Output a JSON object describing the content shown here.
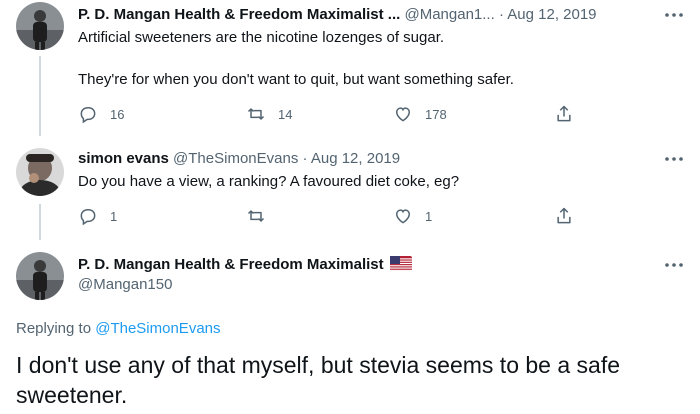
{
  "tweets": [
    {
      "name": "P. D. Mangan Health & Freedom Maximalist ...",
      "handle": "@Mangan1...",
      "dot": "·",
      "date": "Aug 12, 2019",
      "text_line1": "Artificial sweeteners are the nicotine lozenges of sugar.",
      "text_line2": "They're for when you don't want to quit, but want something safer.",
      "replies": "16",
      "retweets": "14",
      "likes": "178"
    },
    {
      "name": "simon evans",
      "handle": "@TheSimonEvans",
      "dot": "·",
      "date": "Aug 12, 2019",
      "text": "Do you have a view, a ranking? A favoured diet coke, eg?",
      "replies": "1",
      "likes": "1"
    }
  ],
  "main_tweet": {
    "name": "P. D. Mangan Health & Freedom Maximalist",
    "flag_icon": "us-flag-icon",
    "handle": "@Mangan150",
    "replying_prefix": "Replying to ",
    "replying_to": "@TheSimonEvans",
    "text_line1": "I don't use any of that myself, but stevia seems to be a safe",
    "text_line2": "sweetener."
  },
  "colors": {
    "text": "#0f1419",
    "secondary": "#536471",
    "link": "#1d9bf0",
    "thread_line": "#cfd9de"
  }
}
